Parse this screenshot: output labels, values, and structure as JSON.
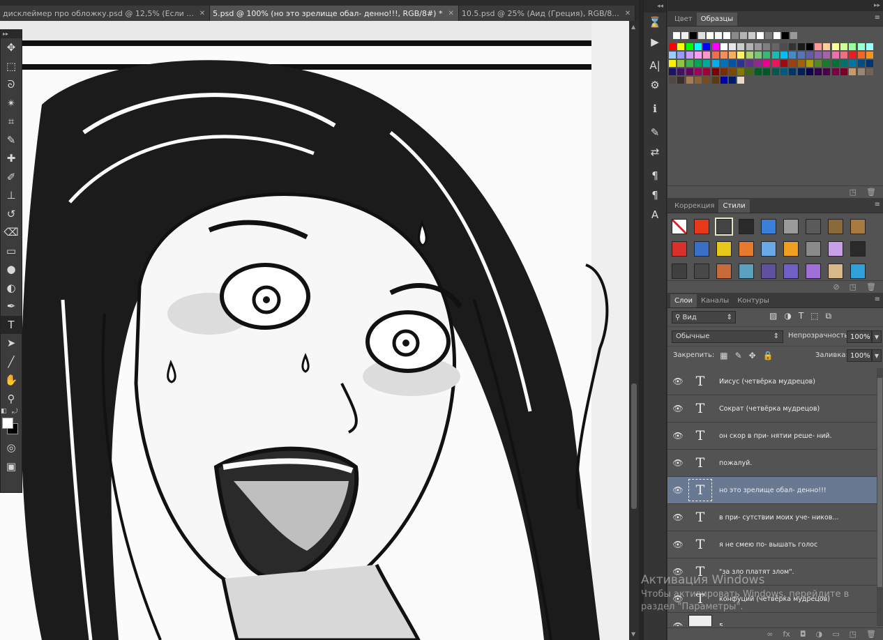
{
  "tabs": [
    {
      "label": "дисклеймер про обложку.psd @ 12,5% (Если ...",
      "active": false
    },
    {
      "label": "5.psd @ 100% (но это  зрелище обал- денно!!!, RGB/8#) *",
      "active": true
    },
    {
      "label": "10.5.psd @ 25% (Аид (Греция), RGB/8...",
      "active": false
    }
  ],
  "tools": [
    "move-icon",
    "marquee-icon",
    "lasso-icon",
    "magic-wand-icon",
    "crop-icon",
    "eyedropper-icon",
    "healing-icon",
    "brush-icon",
    "stamp-icon",
    "history-brush-icon",
    "eraser-icon",
    "gradient-icon",
    "blur-icon",
    "dodge-icon",
    "pen-icon",
    "type-icon",
    "path-select-icon",
    "line-icon",
    "hand-icon",
    "zoom-icon"
  ],
  "tool_glyphs": [
    "✥",
    "⬚",
    "ᘐ",
    "✴",
    "⌗",
    "✎",
    "✚",
    "✐",
    "⊥",
    "↺",
    "⌫",
    "▭",
    "●",
    "◐",
    "✒",
    "T",
    "➤",
    "╱",
    "✋",
    "⚲"
  ],
  "colors": {
    "foreground": "#ffffff",
    "background": "#000000"
  },
  "dock_icons": [
    "history-icon",
    "actions-icon",
    "character-icon",
    "tool-presets-icon",
    "info-icon",
    "brush-presets-icon",
    "adjust-icon",
    "paragraph-icon",
    "paragraph-styles-icon",
    "character-styles-icon"
  ],
  "dock_glyphs": [
    "⌛",
    "▶",
    "A|",
    "⚙",
    "ℹ",
    "✎",
    "⇄",
    "¶",
    "¶",
    "A"
  ],
  "swatches_panel": {
    "tabs": [
      {
        "label": "Цвет",
        "active": false
      },
      {
        "label": "Образцы",
        "active": true
      }
    ],
    "rows": [
      [
        "#ffffff",
        "#f0f0f0",
        "#000000",
        "#e0e0e0",
        "#ffffff",
        "#f8f8f8",
        "#ffffff",
        "#8a8a8a",
        "#b4b4b4",
        "#cccccc",
        "#ffffff",
        "#7a7a7a",
        "#ffffff",
        "#000000",
        "#9a9a9a"
      ],
      [
        "#ff0000",
        "#ffff00",
        "#00ff00",
        "#00ffff",
        "#0000ff",
        "#ff00ff",
        "#ffffff",
        "#e6e6e6",
        "#cccccc",
        "#b3b3b3",
        "#999999",
        "#808080",
        "#666666",
        "#4d4d4d",
        "#333333",
        "#1a1a1a",
        "#000000",
        "#ff9999",
        "#ffcc99",
        "#ffff99",
        "#ccff99",
        "#99ff99",
        "#99ffcc",
        "#99ffff",
        "#99ccff",
        "#9999ff",
        "#cc99ff",
        "#ff99ff",
        "#ff99cc"
      ],
      [
        "#f26c4f",
        "#f68e56",
        "#fbaf5c",
        "#fff467",
        "#acd372",
        "#7cc576",
        "#3bb878",
        "#1abbb4",
        "#00bff3",
        "#438ccb",
        "#5574b9",
        "#605ca8",
        "#855fa8",
        "#a763a8",
        "#f06ea9",
        "#f26d7d",
        "#ed1c24",
        "#f26522",
        "#f7941d",
        "#fff200",
        "#8dc73f",
        "#39b54a",
        "#00a651",
        "#00a99d",
        "#00aeef",
        "#0072bc",
        "#0054a6",
        "#2e3192",
        "#662d91",
        "#92278f",
        "#ec008c",
        "#ed145b"
      ],
      [
        "#9e0b0f",
        "#a0410d",
        "#a36209",
        "#aba000",
        "#598527",
        "#1a7b30",
        "#007236",
        "#00746b",
        "#0076a3",
        "#004b80",
        "#003471",
        "#1b1464",
        "#440e62",
        "#630460",
        "#9e005d",
        "#9e0039",
        "#790000",
        "#7b2e00",
        "#7d4900",
        "#827b00",
        "#406618",
        "#005e20",
        "#005826",
        "#005952",
        "#005b7f",
        "#003663",
        "#002157",
        "#0d004c",
        "#32004b",
        "#4b0049",
        "#7b0046",
        "#7a0026"
      ],
      [
        "#c69c6d",
        "#998675",
        "#736357",
        "#534741",
        "#362f2d",
        "#a67c52",
        "#8c6239",
        "#754c24",
        "#603913",
        "#0000aa",
        "#001a66",
        "#e8dcc8"
      ]
    ]
  },
  "styles_panel": {
    "tabs": [
      {
        "label": "Коррекция",
        "active": false
      },
      {
        "label": "Стили",
        "active": true
      }
    ],
    "items": [
      "#d8d8d8",
      "#e83a1a",
      "#444444",
      "#2a2a2a",
      "#3a7fd8",
      "#9a9a9a",
      "#5a5a5a",
      "#8a6a3a",
      "#a87a40",
      "#d8302a",
      "#3a6fc8",
      "#e8c818",
      "#e87a30",
      "#6aa8e8",
      "#f0a020",
      "#8a8a8a",
      "#c8a0e8",
      "#2a2a2a",
      "#404040",
      "#484848",
      "#c86a3a",
      "#5aa0c0",
      "#6050a0",
      "#7060c8",
      "#a070d8",
      "#d8b888",
      "#30a0d8"
    ]
  },
  "layers_panel": {
    "tabs": [
      {
        "label": "Слои",
        "active": true
      },
      {
        "label": "Каналы",
        "active": false
      },
      {
        "label": "Контуры",
        "active": false
      }
    ],
    "filter_label": "Вид",
    "blend_mode": "Обычные",
    "opacity_label": "Непрозрачность:",
    "opacity_value": "100%",
    "lock_label": "Закрепить:",
    "fill_label": "Заливка:",
    "fill_value": "100%",
    "layers": [
      {
        "name": "Иисус (четвёрка мудрецов)",
        "type": "text",
        "glyph": "T",
        "selected": false
      },
      {
        "name": "Сократ (четвёрка мудрецов)",
        "type": "text",
        "glyph": "T",
        "selected": false
      },
      {
        "name": "он  скор  в при- нятии  реше- ний.",
        "type": "text",
        "glyph": "T",
        "selected": false
      },
      {
        "name": "пожалуй.",
        "type": "text",
        "glyph": "T",
        "selected": false
      },
      {
        "name": "но это  зрелище обал- денно!!!",
        "type": "text",
        "glyph": "T",
        "selected": true
      },
      {
        "name": " в при- сутствии  моих уче-   ников...",
        "type": "text",
        "glyph": "T",
        "selected": false
      },
      {
        "name": "я не   смею по- вышать  голос",
        "type": "text",
        "glyph": "T",
        "selected": false
      },
      {
        "name": "\"за зло  платят  злом\".",
        "type": "text",
        "glyph": "T",
        "selected": false
      },
      {
        "name": "конфуций (четвёрка мудрецов)",
        "type": "text",
        "glyph": "T",
        "selected": false
      },
      {
        "name": "5",
        "type": "image",
        "glyph": "",
        "selected": false
      }
    ]
  },
  "watermark": {
    "title": "Активация Windows",
    "body": "Чтобы активировать Windows, перейдите в раздел \"Параметры\"."
  }
}
